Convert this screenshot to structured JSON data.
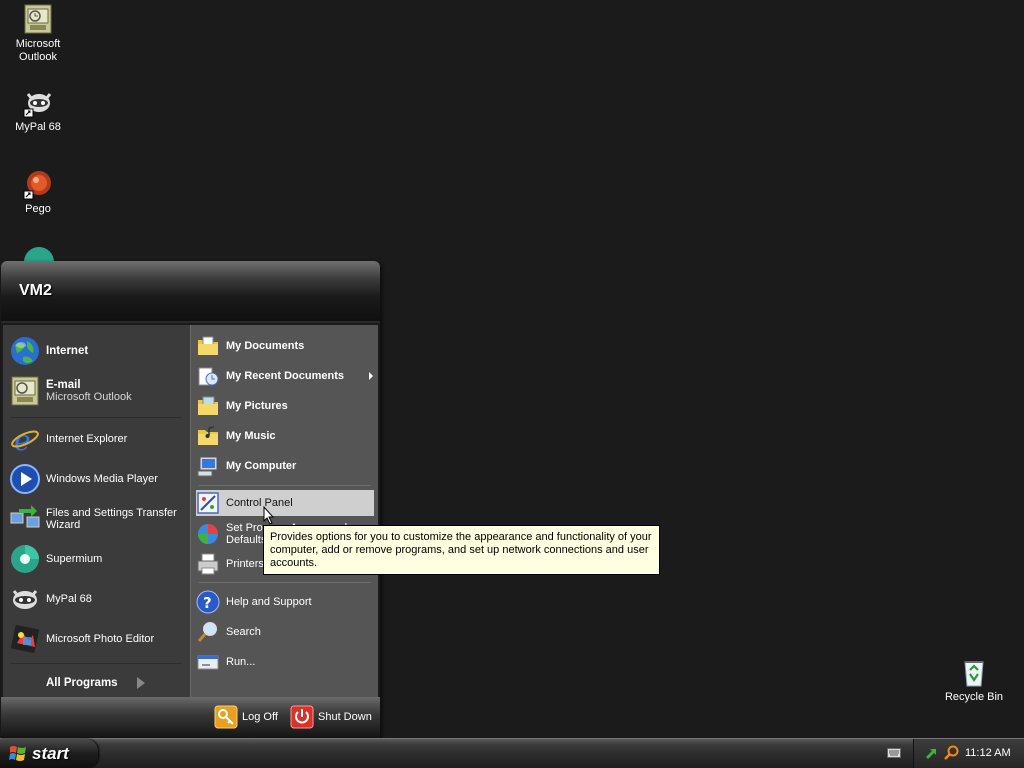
{
  "desktop": {
    "icons": [
      {
        "name": "desktop-icon-microsoft-outlook",
        "label": "Microsoft Outlook"
      },
      {
        "name": "desktop-icon-mypal",
        "label": "MyPal 68"
      },
      {
        "name": "desktop-icon-pego",
        "label": "Pego"
      },
      {
        "name": "desktop-icon-recycle-bin",
        "label": "Recycle Bin"
      }
    ]
  },
  "start_menu": {
    "username": "VM2",
    "pinned": [
      {
        "label": "Internet",
        "icon": "globe-icon"
      },
      {
        "label": "E-mail",
        "sublabel": "Microsoft Outlook",
        "icon": "outlook-icon"
      }
    ],
    "recent": [
      {
        "label": "Internet Explorer",
        "icon": "internet-explorer-icon"
      },
      {
        "label": "Windows Media Player",
        "icon": "media-player-icon"
      },
      {
        "label": "Files and Settings Transfer Wizard",
        "icon": "transfer-wizard-icon"
      },
      {
        "label": "Supermium",
        "icon": "supermium-icon"
      },
      {
        "label": "MyPal 68",
        "icon": "mypal-icon"
      },
      {
        "label": "Microsoft Photo Editor",
        "icon": "photo-editor-icon"
      }
    ],
    "all_programs": "All Programs",
    "places": [
      {
        "label": "My Documents",
        "icon": "folder-documents-icon"
      },
      {
        "label": "My Recent Documents",
        "icon": "recent-documents-icon"
      },
      {
        "label": "My Pictures",
        "icon": "folder-pictures-icon"
      },
      {
        "label": "My Music",
        "icon": "folder-music-icon"
      },
      {
        "label": "My Computer",
        "icon": "computer-icon"
      }
    ],
    "system": [
      {
        "label": "Control Panel",
        "icon": "control-panel-icon"
      },
      {
        "label": "Set Program Access and Defaults",
        "icon": "program-defaults-icon"
      },
      {
        "label": "Printers and Faxes",
        "icon": "printer-icon"
      }
    ],
    "help": [
      {
        "label": "Help and Support",
        "icon": "help-icon"
      },
      {
        "label": "Search",
        "icon": "search-icon"
      },
      {
        "label": "Run...",
        "icon": "run-icon"
      }
    ],
    "log_off": "Log Off",
    "shut_down": "Shut Down"
  },
  "tooltip": {
    "text": "Provides options for you to customize the appearance and functionality of your computer, add or remove programs, and set up network connections and user accounts."
  },
  "taskbar": {
    "start_label": "start",
    "clock": "11:12 AM"
  }
}
